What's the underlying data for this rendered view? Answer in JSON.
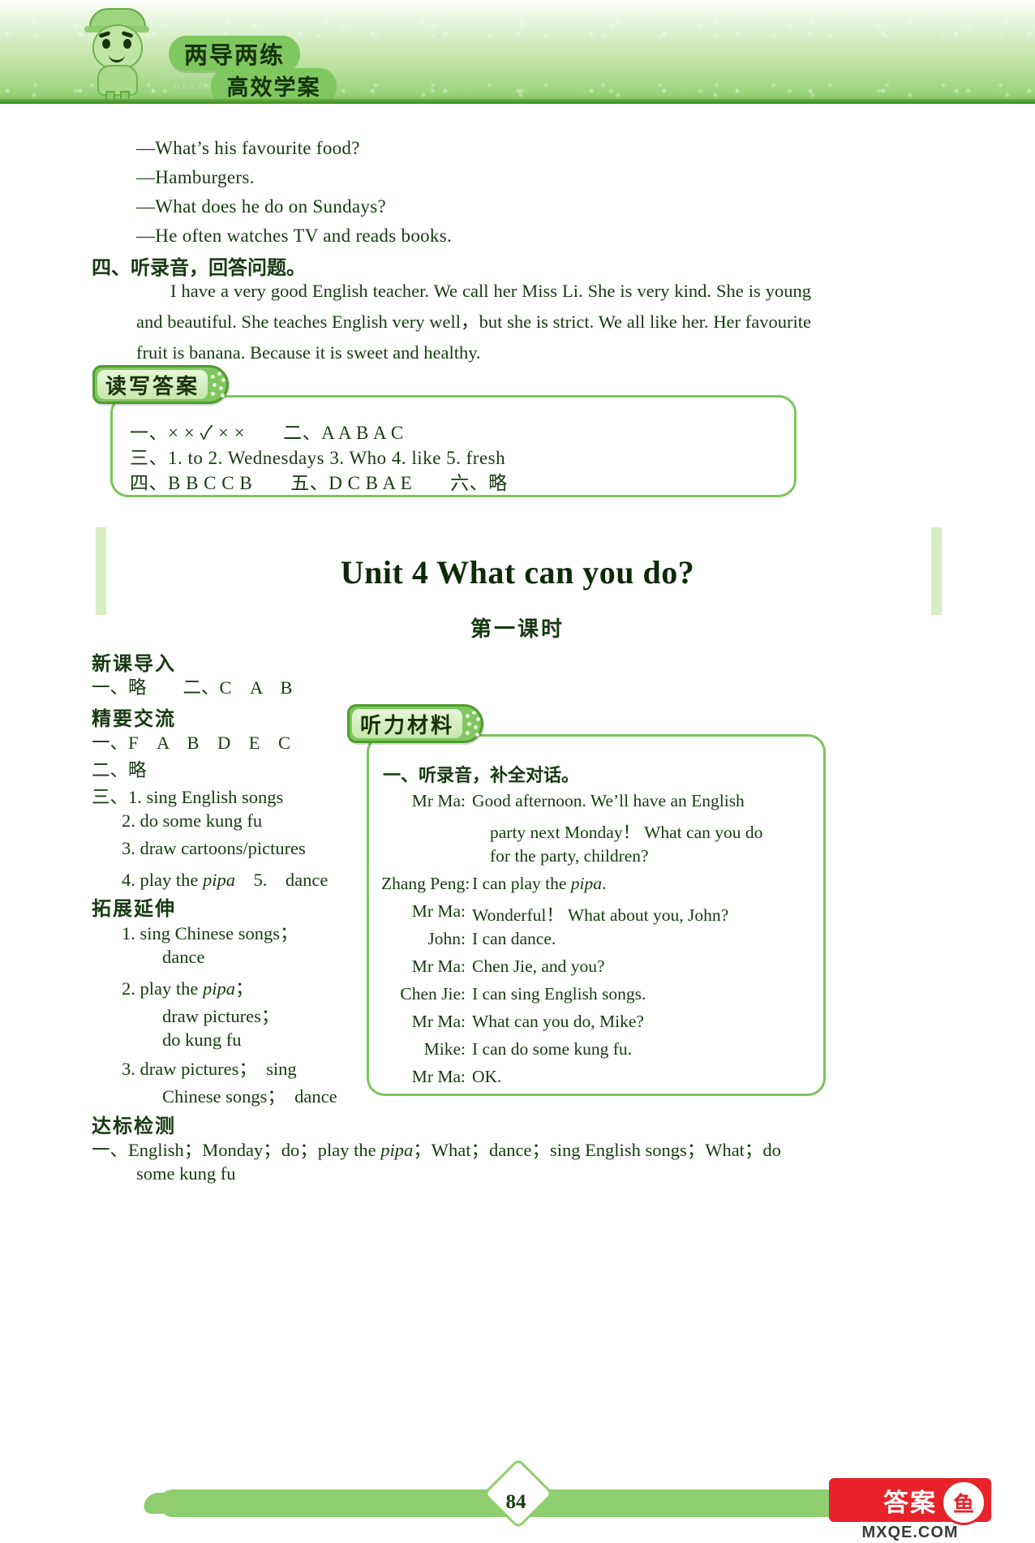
{
  "banner": {
    "logo_main": "两导两练",
    "logo_sub": "高效学案",
    "pinyin_line1": "LIANGDAOLIANGLIAN",
    "pinyin_line2": "GAOXIAOXUEAN",
    "mascot_name": "green-boy-mascot",
    "accent_green": "#7fc75f",
    "dark_green": "#163a10"
  },
  "top_dialogue": [
    "—What’s his favourite food?",
    "—Hamburgers.",
    "—What does he do on Sundays?",
    "—He often watches TV and reads books."
  ],
  "section4": {
    "heading": "四、听录音，回答问题。",
    "paragraph": "I have a very good English teacher.  We call her Miss Li.  She is very kind.  She is young and beautiful.  She teaches English very well，but she is strict.  We all like her.  Her favourite fruit is banana.  Because it is sweet and healthy."
  },
  "answer_box": {
    "tab_label": "读写答案",
    "lines": [
      "一、× × ✓ × ×　　二、A A B A C",
      "三、1. to  2. Wednesdays  3. Who  4. like  5. fresh",
      "四、B B C C B　　五、D C B A E　　六、略"
    ]
  },
  "unit": {
    "title": "Unit 4 What can you do?",
    "lesson": "第一课时"
  },
  "left_column": {
    "h1": "新课导入",
    "l1": "一、略　　二、C　A　B",
    "h2": "精要交流",
    "l2": "一、F　A　B　D　E　C",
    "l3": "二、略",
    "l4_prefix": "三、1.",
    "l4": "sing English songs",
    "l5_num": "2.",
    "l5": "do some kung fu",
    "l6_num": "3.",
    "l6": "draw cartoons/pictures",
    "l7_num": "4.",
    "l7a": "play the ",
    "l7b": "pipa",
    "l7c": "　5.　dance",
    "h3": "拓展延伸",
    "e1_num": "1.",
    "e1": "sing Chinese songs；",
    "e1b": "dance",
    "e2_num": "2.",
    "e2a": "play the ",
    "e2b": "pipa",
    "e2c": "；",
    "e2d": "draw pictures；",
    "e2e": "do kung fu",
    "e3_num": "3.",
    "e3a": "draw pictures；　sing",
    "e3b": "Chinese songs；　dance",
    "h4": "达标检测",
    "t1a": "一、English；Monday；do；play the ",
    "t1b": "pipa",
    "t1c": "；What；dance；sing English songs；What；do",
    "t1d": "some kung fu"
  },
  "listening_box": {
    "tab_label": "听力材料",
    "heading": "一、听录音，补全对话。",
    "dialogue": [
      {
        "speaker": "Mr Ma:",
        "text": "Good afternoon. We’ll have an English"
      },
      {
        "speaker": "",
        "text": "party next Monday！ What can you do"
      },
      {
        "speaker": "",
        "text": "for the party, children?"
      },
      {
        "speaker": "Zhang Peng:",
        "text": "I can play the pipa."
      },
      {
        "speaker": "Mr Ma:",
        "text": "Wonderful！ What about you, John?"
      },
      {
        "speaker": "John:",
        "text": "I can dance."
      },
      {
        "speaker": "Mr Ma:",
        "text": "Chen Jie, and you?"
      },
      {
        "speaker": "Chen Jie:",
        "text": "I can sing English songs."
      },
      {
        "speaker": "Mr Ma:",
        "text": "What can you do, Mike?"
      },
      {
        "speaker": "Mike:",
        "text": "I can do some kung fu."
      },
      {
        "speaker": "Mr Ma:",
        "text": "OK."
      }
    ]
  },
  "footer": {
    "page_number": "84",
    "watermark_text": "答案",
    "watermark_badge": "鱼",
    "watermark_url": "MXQE.COM",
    "watermark_color": "#e8222a"
  }
}
